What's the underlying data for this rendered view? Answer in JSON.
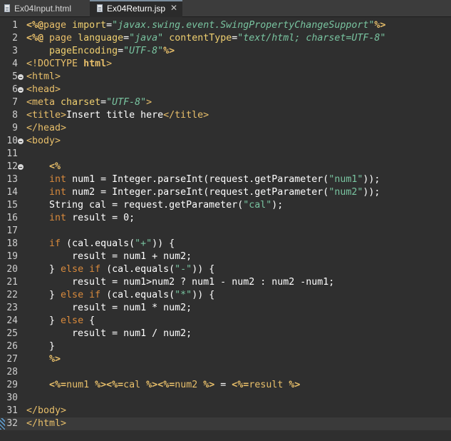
{
  "tabs": [
    {
      "label": "Ex04Input.html",
      "active": false
    },
    {
      "label": "Ex04Return.jsp",
      "active": true
    }
  ],
  "tab_close_glyph": "✕",
  "colors": {
    "background": "#2f2f2f",
    "tag": "#e8bf6a",
    "string": "#79c4a0",
    "keyword": "#d88a3c",
    "text": "#ffffff"
  },
  "current_line": 32,
  "fold_lines": [
    5,
    6,
    10,
    12
  ],
  "lines": [
    {
      "n": "1",
      "tokens": [
        [
          "jsp",
          "<%@"
        ],
        [
          "tag",
          "page "
        ],
        [
          "attr",
          "import"
        ],
        [
          "eq",
          "="
        ],
        [
          "string",
          "\"javax.swing.event.SwingPropertyChangeSupport\""
        ],
        [
          "jsp",
          "%>"
        ]
      ]
    },
    {
      "n": "2",
      "tokens": [
        [
          "jsp",
          "<%@ "
        ],
        [
          "tag",
          "page "
        ],
        [
          "attr",
          "language"
        ],
        [
          "eq",
          "="
        ],
        [
          "string",
          "\"java\""
        ],
        [
          "plain",
          " "
        ],
        [
          "attr",
          "contentType"
        ],
        [
          "eq",
          "="
        ],
        [
          "string",
          "\"text/html; charset=UTF-8\""
        ]
      ]
    },
    {
      "n": "3",
      "tokens": [
        [
          "plain",
          "    "
        ],
        [
          "attr",
          "pageEncoding"
        ],
        [
          "eq",
          "="
        ],
        [
          "string",
          "\"UTF-8\""
        ],
        [
          "jsp",
          "%>"
        ]
      ]
    },
    {
      "n": "4",
      "tokens": [
        [
          "doctype",
          "<!DOCTYPE "
        ],
        [
          "jsp",
          "html"
        ],
        [
          "doctype",
          ">"
        ]
      ]
    },
    {
      "n": "5",
      "tokens": [
        [
          "tag",
          "<html>"
        ]
      ]
    },
    {
      "n": "6",
      "tokens": [
        [
          "tag",
          "<head>"
        ]
      ]
    },
    {
      "n": "7",
      "tokens": [
        [
          "tag",
          "<meta "
        ],
        [
          "attr",
          "charset"
        ],
        [
          "eq",
          "="
        ],
        [
          "string",
          "\"UTF-8\""
        ],
        [
          "tag",
          ">"
        ]
      ]
    },
    {
      "n": "8",
      "tokens": [
        [
          "tag",
          "<title>"
        ],
        [
          "plain",
          "Insert title here"
        ],
        [
          "tag",
          "</title>"
        ]
      ]
    },
    {
      "n": "9",
      "tokens": [
        [
          "tag",
          "</head>"
        ]
      ]
    },
    {
      "n": "10",
      "tokens": [
        [
          "tag",
          "<body>"
        ]
      ]
    },
    {
      "n": "11",
      "tokens": []
    },
    {
      "n": "12",
      "tokens": [
        [
          "plain",
          "    "
        ],
        [
          "jsp",
          "<%"
        ]
      ]
    },
    {
      "n": "13",
      "tokens": [
        [
          "plain",
          "    "
        ],
        [
          "keyword",
          "int"
        ],
        [
          "plain",
          " num1 = Integer.parseInt(request.getParameter("
        ],
        [
          "literal",
          "\"num1\""
        ],
        [
          "plain",
          "));"
        ]
      ]
    },
    {
      "n": "14",
      "tokens": [
        [
          "plain",
          "    "
        ],
        [
          "keyword",
          "int"
        ],
        [
          "plain",
          " num2 = Integer.parseInt(request.getParameter("
        ],
        [
          "literal",
          "\"num2\""
        ],
        [
          "plain",
          "));"
        ]
      ]
    },
    {
      "n": "15",
      "tokens": [
        [
          "plain",
          "    String cal = request.getParameter("
        ],
        [
          "literal",
          "\"cal\""
        ],
        [
          "plain",
          ");"
        ]
      ]
    },
    {
      "n": "16",
      "tokens": [
        [
          "plain",
          "    "
        ],
        [
          "keyword",
          "int"
        ],
        [
          "plain",
          " result = 0;"
        ]
      ]
    },
    {
      "n": "17",
      "tokens": []
    },
    {
      "n": "18",
      "tokens": [
        [
          "plain",
          "    "
        ],
        [
          "keyword",
          "if"
        ],
        [
          "plain",
          " (cal.equals("
        ],
        [
          "literal",
          "\"+\""
        ],
        [
          "plain",
          ")) {"
        ]
      ]
    },
    {
      "n": "19",
      "tokens": [
        [
          "plain",
          "        result = num1 + num2;"
        ]
      ]
    },
    {
      "n": "20",
      "tokens": [
        [
          "plain",
          "    } "
        ],
        [
          "keyword",
          "else if"
        ],
        [
          "plain",
          " (cal.equals("
        ],
        [
          "literal",
          "\"-\""
        ],
        [
          "plain",
          ")) {"
        ]
      ]
    },
    {
      "n": "21",
      "tokens": [
        [
          "plain",
          "        result = num1>num2 ? num1 - num2 : num2 -num1;"
        ]
      ]
    },
    {
      "n": "22",
      "tokens": [
        [
          "plain",
          "    } "
        ],
        [
          "keyword",
          "else if"
        ],
        [
          "plain",
          " (cal.equals("
        ],
        [
          "literal",
          "\"*\""
        ],
        [
          "plain",
          ")) {"
        ]
      ]
    },
    {
      "n": "23",
      "tokens": [
        [
          "plain",
          "        result = num1 * num2;"
        ]
      ]
    },
    {
      "n": "24",
      "tokens": [
        [
          "plain",
          "    } "
        ],
        [
          "keyword",
          "else"
        ],
        [
          "plain",
          " {"
        ]
      ]
    },
    {
      "n": "25",
      "tokens": [
        [
          "plain",
          "        result = num1 / num2;"
        ]
      ]
    },
    {
      "n": "26",
      "tokens": [
        [
          "plain",
          "    }"
        ]
      ]
    },
    {
      "n": "27",
      "tokens": [
        [
          "plain",
          "    "
        ],
        [
          "jsp",
          "%>"
        ]
      ]
    },
    {
      "n": "28",
      "tokens": []
    },
    {
      "n": "29",
      "tokens": [
        [
          "plain",
          "    "
        ],
        [
          "jsp",
          "<%="
        ],
        [
          "tag",
          "num1 "
        ],
        [
          "jsp",
          "%>"
        ],
        [
          "jsp",
          "<%="
        ],
        [
          "tag",
          "cal "
        ],
        [
          "jsp",
          "%>"
        ],
        [
          "jsp",
          "<%="
        ],
        [
          "tag",
          "num2 "
        ],
        [
          "jsp",
          "%>"
        ],
        [
          "plain",
          " = "
        ],
        [
          "jsp",
          "<%="
        ],
        [
          "tag",
          "result "
        ],
        [
          "jsp",
          "%>"
        ]
      ]
    },
    {
      "n": "30",
      "tokens": []
    },
    {
      "n": "31",
      "tokens": [
        [
          "tag",
          "</body>"
        ]
      ]
    },
    {
      "n": "32",
      "tokens": [
        [
          "tag",
          "</html>"
        ]
      ]
    }
  ]
}
